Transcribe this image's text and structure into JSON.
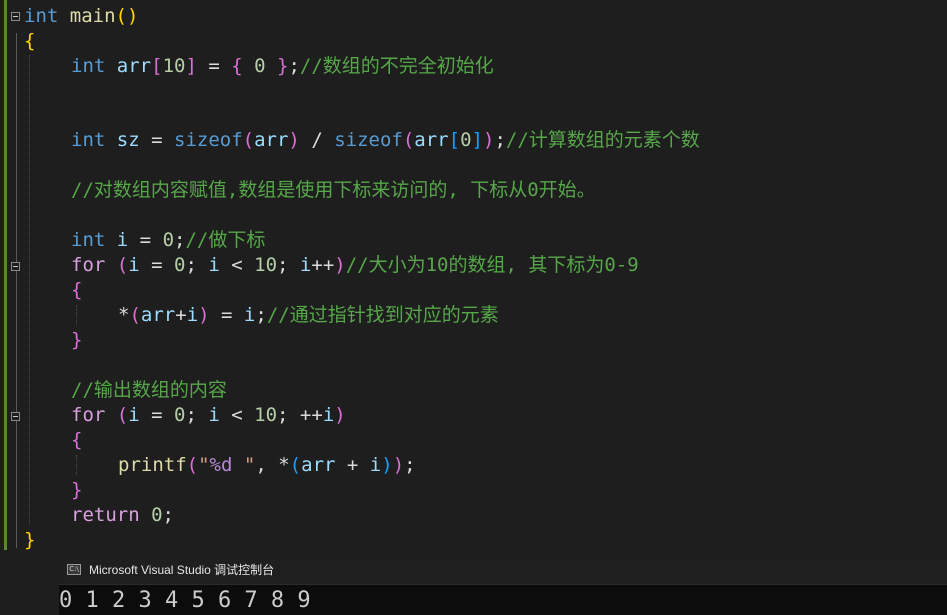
{
  "editor": {
    "lines": {
      "l1": [
        "int",
        " ",
        "main",
        "(",
        ")"
      ],
      "l2": [
        "{"
      ],
      "l3": [
        "int",
        " ",
        "arr",
        "[",
        "10",
        "]",
        " = ",
        "{",
        " 0 ",
        "}",
        ";",
        "//数组的不完全初始化"
      ],
      "l4": [
        "int",
        " ",
        "sz",
        " = ",
        "sizeof",
        "(",
        "arr",
        ")",
        " / ",
        "sizeof",
        "(",
        "arr",
        "[",
        "0",
        "]",
        ")",
        ";",
        "//计算数组的元素个数"
      ],
      "l5": [
        "//对数组内容赋值,数组是使用下标来访问的, 下标从0开始。"
      ],
      "l6": [
        "int",
        " ",
        "i",
        " = ",
        "0",
        ";",
        "//做下标"
      ],
      "l7": [
        "for",
        " ",
        "(",
        "i",
        " = ",
        "0",
        "; ",
        "i",
        " < ",
        "10",
        "; ",
        "i",
        "++",
        ")",
        "//大小为10的数组, 其下标为0-9"
      ],
      "l8": [
        "{"
      ],
      "l9": [
        "*",
        "(",
        "arr",
        "+",
        "i",
        ")",
        " = ",
        "i",
        ";",
        "//通过指针找到对应的元素"
      ],
      "l10": [
        "}"
      ],
      "l11": [
        "//输出数组的内容"
      ],
      "l12": [
        "for",
        " ",
        "(",
        "i",
        " = ",
        "0",
        "; ",
        "i",
        " < ",
        "10",
        "; ",
        "++",
        "i",
        ")"
      ],
      "l13": [
        "{"
      ],
      "l14": [
        "printf",
        "(",
        "\"",
        "%d",
        " \"",
        ", ",
        "*",
        "(",
        "arr",
        " + ",
        "i",
        ")",
        ")",
        ";"
      ],
      "l15": [
        "}"
      ],
      "l16": [
        "return",
        " ",
        "0",
        ";"
      ],
      "l17": [
        "}"
      ]
    }
  },
  "console": {
    "title": "Microsoft Visual Studio 调试控制台",
    "icon": "C:\\",
    "output": "0 1 2 3 4 5 6 7 8 9"
  }
}
